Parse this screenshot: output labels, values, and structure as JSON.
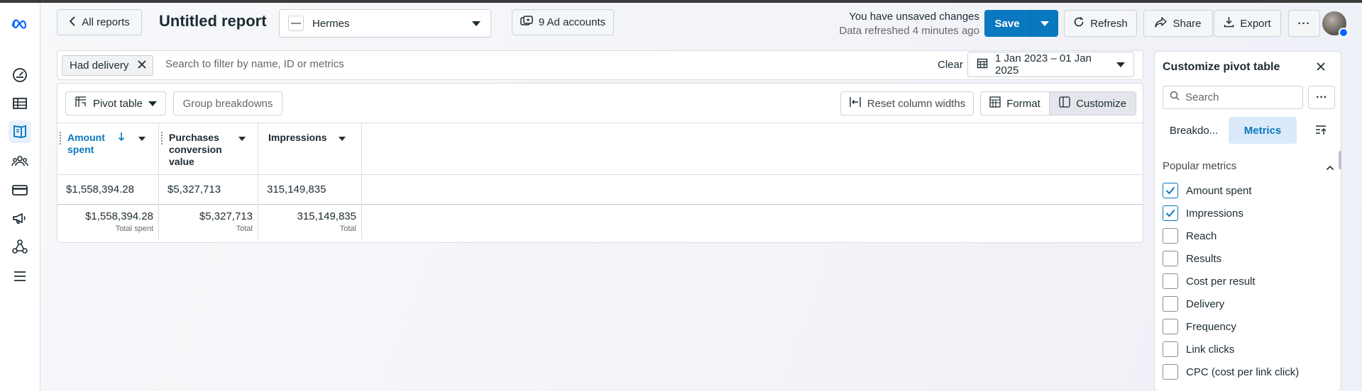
{
  "header": {
    "back_label": "All reports",
    "title": "Untitled report",
    "account": "Hermes",
    "ad_accounts": "9 Ad accounts",
    "unsaved": "You have unsaved changes",
    "refreshed": "Data refreshed 4 minutes ago",
    "save": "Save",
    "refresh": "Refresh",
    "share": "Share",
    "export": "Export"
  },
  "filters": {
    "chip": "Had delivery",
    "placeholder": "Search to filter by name, ID or metrics",
    "clear": "Clear",
    "date_range": "1 Jan 2023 – 01 Jan 2025"
  },
  "toolbar": {
    "pivot": "Pivot table",
    "group": "Group breakdowns",
    "reset": "Reset column widths",
    "format": "Format",
    "customize": "Customize"
  },
  "table": {
    "columns": [
      {
        "label": "Amount spent",
        "sorted": "desc"
      },
      {
        "label": "Purchases conversion value"
      },
      {
        "label": "Impressions"
      }
    ],
    "rows": [
      [
        "$1,558,394.28",
        "$5,327,713",
        "315,149,835"
      ]
    ],
    "totals": [
      {
        "value": "$1,558,394.28",
        "sub": "Total spent"
      },
      {
        "value": "$5,327,713",
        "sub": "Total"
      },
      {
        "value": "315,149,835",
        "sub": "Total"
      }
    ]
  },
  "customize": {
    "title": "Customize pivot table",
    "search_placeholder": "Search",
    "tabs": [
      "Breakdo...",
      "Metrics"
    ],
    "active_tab": "Metrics",
    "section": "Popular metrics",
    "metrics": [
      {
        "label": "Amount spent",
        "checked": true
      },
      {
        "label": "Impressions",
        "checked": true
      },
      {
        "label": "Reach",
        "checked": false
      },
      {
        "label": "Results",
        "checked": false
      },
      {
        "label": "Cost per result",
        "checked": false
      },
      {
        "label": "Delivery",
        "checked": false
      },
      {
        "label": "Frequency",
        "checked": false
      },
      {
        "label": "Link clicks",
        "checked": false
      },
      {
        "label": "CPC (cost per link click)",
        "checked": false
      }
    ]
  },
  "colors": {
    "accent": "#0a78be",
    "accent_bg": "#dbeafb",
    "border": "#dadde1"
  },
  "icons": [
    "meta-logo-icon",
    "gauge-icon",
    "table-icon",
    "reports-icon",
    "audience-icon",
    "billing-card-icon",
    "megaphone-icon",
    "events-icon",
    "menu-icon"
  ]
}
